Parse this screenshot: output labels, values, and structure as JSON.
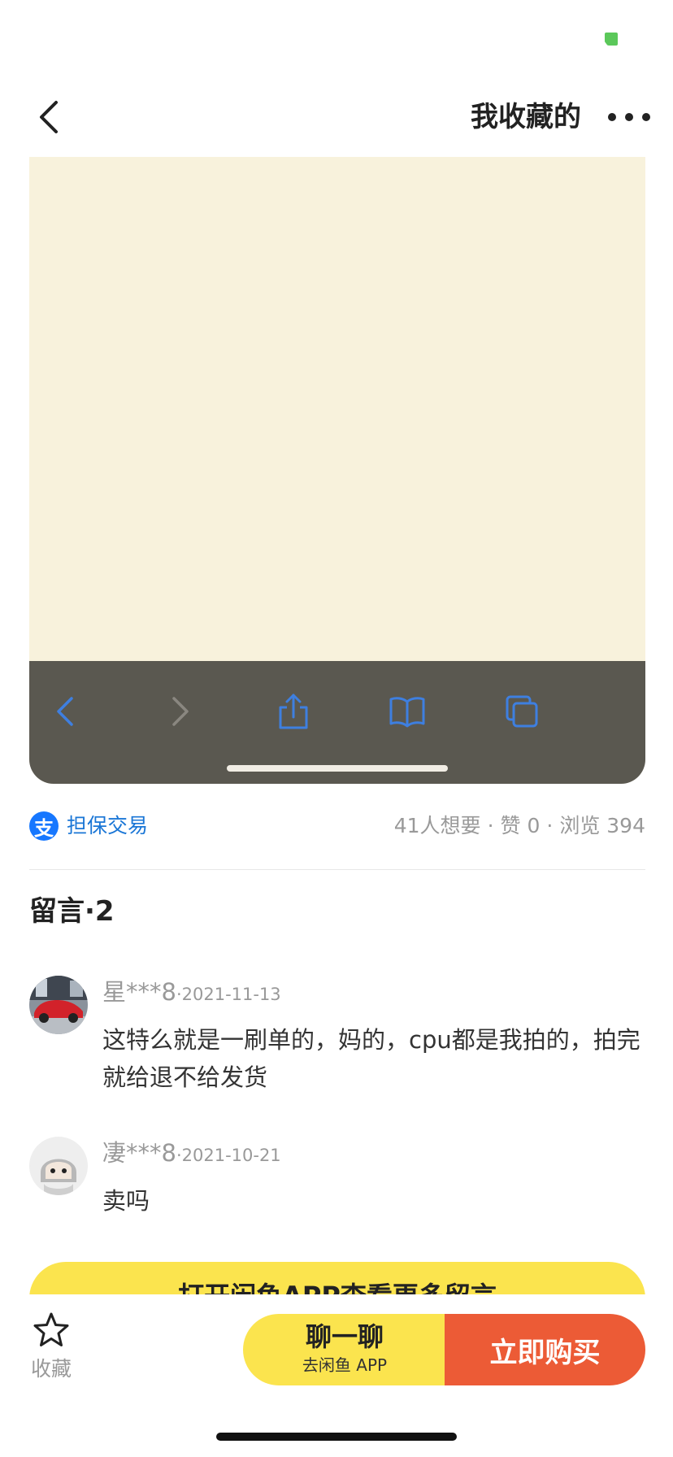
{
  "colors": {
    "accent_yellow": "#fbe44e",
    "buy_orange": "#ec5b36",
    "link_blue": "#1a76d6",
    "media_bg": "#f8f2dc",
    "safari_bar": "#5a5850",
    "safari_icon": "#3e7fe0"
  },
  "header": {
    "title": "我收藏的",
    "back_icon": "chevron-left-icon",
    "more_icon": "more-dots-icon"
  },
  "media": {
    "toolbar_icons": [
      "back-arrow-icon",
      "forward-arrow-icon",
      "share-icon",
      "bookmarks-icon",
      "tabs-icon"
    ]
  },
  "meta": {
    "alipay_glyph": "支",
    "guarantee_label": "担保交易",
    "wants": "41人想要",
    "likes": "赞 0",
    "views": "浏览 394",
    "separator": "·"
  },
  "comments": {
    "title": "留言·2",
    "items": [
      {
        "user": "星***8",
        "date": "·2021-11-13",
        "text": "这特么就是一刷单的，妈的，cpu都是我拍的，拍完就给退不给发货"
      },
      {
        "user": "凄***8",
        "date": "·2021-10-21",
        "text": "卖吗"
      }
    ],
    "open_app_label": "打开闲鱼APP查看更多留言"
  },
  "bottom_bar": {
    "favorite_label": "收藏",
    "chat_label": "聊一聊",
    "chat_sub": "去闲鱼 APP",
    "buy_label": "立即购买"
  }
}
